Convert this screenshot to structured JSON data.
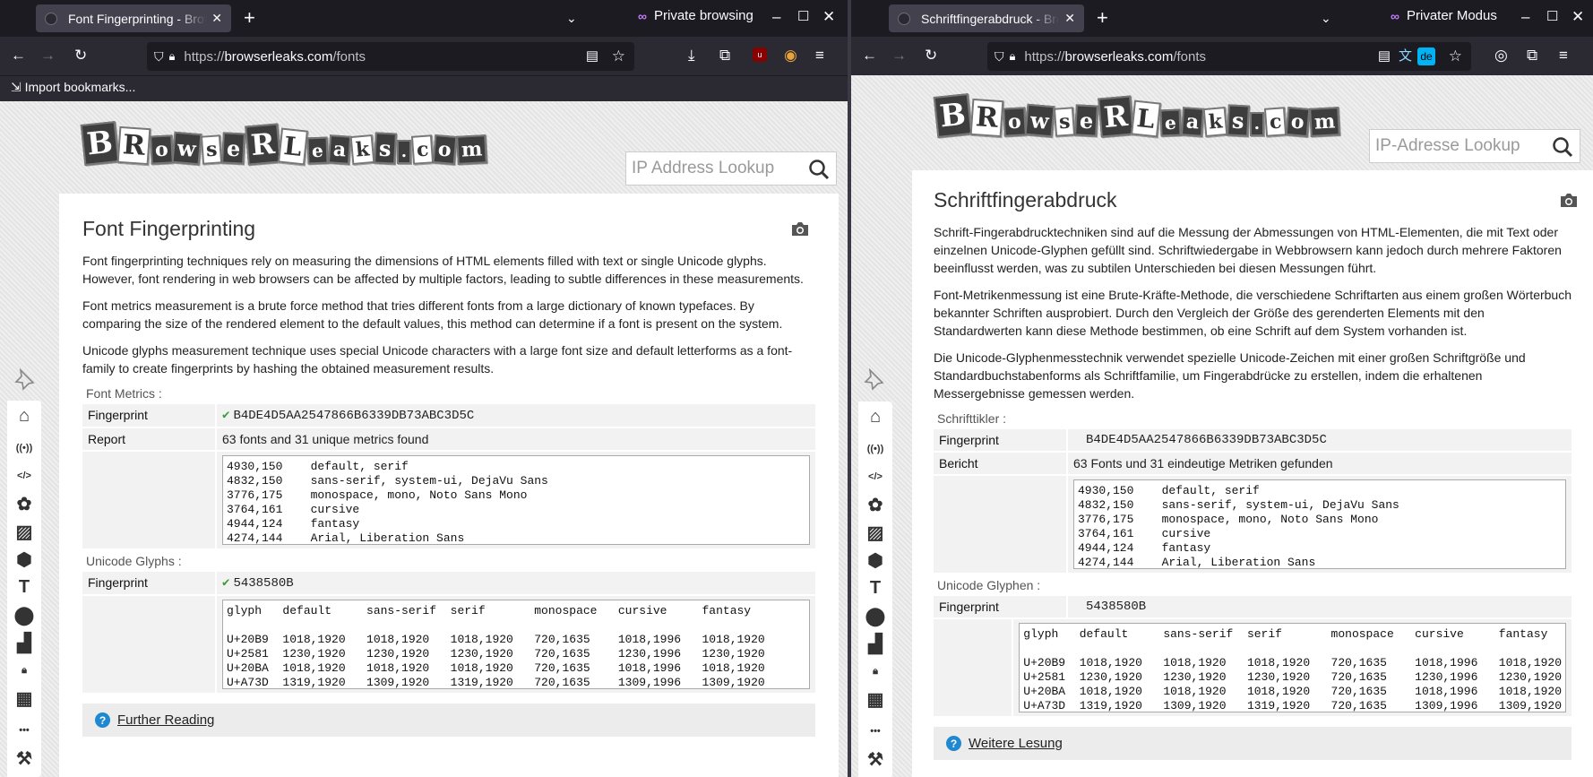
{
  "left": {
    "tab_title": "Font Fingerprinting - Browser",
    "private_label": "Private browsing",
    "url": {
      "pre": "https://",
      "domain": "browserleaks.com",
      "path": "/fonts"
    },
    "bookmarks_import": "Import bookmarks...",
    "search_placeholder": "IP Address Lookup",
    "title": "Font Fingerprinting",
    "paragraphs": [
      "Font fingerprinting techniques rely on measuring the dimensions of HTML elements filled with text or single Unicode glyphs. However, font rendering in web browsers can be affected by multiple factors, leading to subtle differences in these measurements.",
      "Font metrics measurement is a brute force method that tries different fonts from a large dictionary of known typefaces. By comparing the size of the rendered element to the default values, this method can determine if a font is present on the system.",
      "Unicode glyphs measurement technique uses special Unicode characters with a large font size and default letterforms as a font-family to create fingerprints by hashing the obtained measurement results."
    ],
    "font_metrics_label": "Font Metrics :",
    "fingerprint_label": "Fingerprint",
    "fingerprint_check": "✔",
    "font_fp": "B4DE4D5AA2547866B6339DB73ABC3D5C",
    "report_label": "Report",
    "report_value": "63 fonts and 31 unique metrics found",
    "metrics": "4930,150    default, serif\n4832,150    sans-serif, system-ui, DejaVu Sans\n3776,175    monospace, mono, Noto Sans Mono\n3764,161    cursive\n4944,124    fantasy\n4274,144    Arial, Liberation Sans",
    "unicode_label": "Unicode Glyphs :",
    "unicode_fp": "5438580B",
    "glyphs": "glyph   default     sans-serif  serif       monospace   cursive     fantasy\n\nU+20B9  1018,1920   1018,1920   1018,1920   720,1635    1018,1996   1018,1920\nU+2581  1230,1920   1230,1920   1230,1920   720,1635    1230,1996   1230,1920\nU+20BA  1018,1920   1018,1920   1018,1920   720,1635    1018,1996   1018,1920\nU+A73D  1319,1920   1309,1920   1319,1920   720,1635    1309,1996   1309,1920",
    "further_reading": "Further Reading"
  },
  "right": {
    "tab_title": "Schriftfingerabdruck - Browser",
    "private_label": "Privater Modus",
    "url": {
      "pre": "https://",
      "domain": "browserleaks.com",
      "path": "/fonts"
    },
    "translate_badge": "de",
    "search_placeholder": "IP-Adresse Lookup",
    "title": "Schriftfingerabdruck",
    "paragraphs": [
      "Schrift-Fingerabdrucktechniken sind auf die Messung der Abmessungen von HTML-Elementen, die mit Text oder einzelnen Unicode-Glyphen gefüllt sind. Schriftwiedergabe in Webbrowsern kann jedoch durch mehrere Faktoren beeinflusst werden, was zu subtilen Unterschieden bei diesen Messungen führt.",
      "Font-Metrikenmessung ist eine Brute-Kräfte-Methode, die verschiedene Schriftarten aus einem großen Wörterbuch bekannter Schriften ausprobiert. Durch den Vergleich der Größe des gerenderten Elements mit den Standardwerten kann diese Methode bestimmen, ob eine Schrift auf dem System vorhanden ist.",
      "Die Unicode-Glyphenmesstechnik verwendet spezielle Unicode-Zeichen mit einer großen Schriftgröße und Standardbuchstabenforms als Schriftfamilie, um Fingerabdrücke zu erstellen, indem die erhaltenen Messergebnisse gemessen werden."
    ],
    "font_metrics_label": "Schrifttikler :",
    "fingerprint_label": "Fingerprint",
    "font_fp": "B4DE4D5AA2547866B6339DB73ABC3D5C",
    "report_label": "Bericht",
    "report_value": "63 Fonts und 31 eindeutige Metriken gefunden",
    "metrics": "4930,150    default, serif\n4832,150    sans-serif, system-ui, DejaVu Sans\n3776,175    monospace, mono, Noto Sans Mono\n3764,161    cursive\n4944,124    fantasy\n4274,144    Arial, Liberation Sans",
    "unicode_label": "Unicode Glyphen :",
    "unicode_fp": "5438580B",
    "glyphs": "glyph   default     sans-serif  serif       monospace   cursive     fantasy\n\nU+20B9  1018,1920   1018,1920   1018,1920   720,1635    1018,1996   1018,1920\nU+2581  1230,1920   1230,1920   1230,1920   720,1635    1230,1996   1230,1920\nU+20BA  1018,1920   1018,1920   1018,1920   720,1635    1018,1996   1018,1920\nU+A73D  1319,1920   1309,1920   1319,1920   720,1635    1309,1996   1309,1920",
    "further_reading": "Weitere Lesung"
  },
  "logo_letters": [
    "B",
    "R",
    "o",
    "w",
    "s",
    "e",
    "R",
    "L",
    "e",
    "a",
    "k",
    "s",
    ".",
    "c",
    "o",
    "m"
  ]
}
